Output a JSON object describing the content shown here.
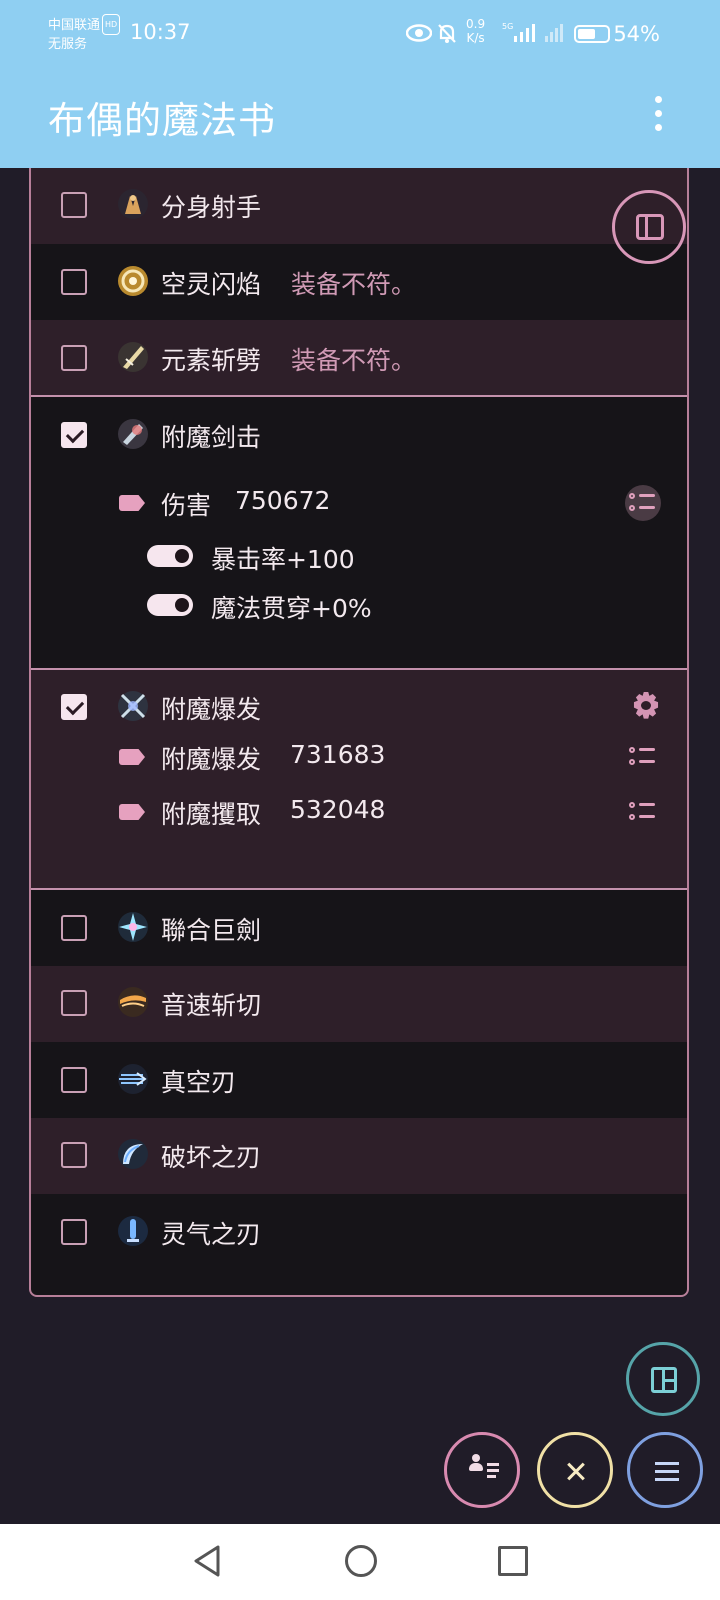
{
  "status_bar": {
    "carrier": "中国联通",
    "carrier_badge": "HD",
    "service": "无服务",
    "time": "10:37",
    "net_speed_value": "0.9",
    "net_speed_unit": "K/s",
    "signal_label": "5G",
    "battery": "54%"
  },
  "app_bar": {
    "title": "布偶的魔法书",
    "more_icon": "more-vert-icon"
  },
  "skills": [
    {
      "name": "分身射手",
      "checked": false,
      "note": ""
    },
    {
      "name": "空灵闪焰",
      "checked": false,
      "note": "装备不符。"
    },
    {
      "name": "元素斩劈",
      "checked": false,
      "note": "装备不符。"
    },
    {
      "name": "附魔剑击",
      "checked": true,
      "note": ""
    },
    {
      "name": "附魔爆发",
      "checked": true,
      "note": ""
    },
    {
      "name": "聯合巨劍",
      "checked": false,
      "note": ""
    },
    {
      "name": "音速斩切",
      "checked": false,
      "note": ""
    },
    {
      "name": "真空刃",
      "checked": false,
      "note": ""
    },
    {
      "name": "破坏之刃",
      "checked": false,
      "note": ""
    },
    {
      "name": "灵气之刃",
      "checked": false,
      "note": ""
    }
  ],
  "enchant_strike": {
    "damage_label": "伤害",
    "damage_value": "750672",
    "toggles": [
      {
        "label": "暴击率+100",
        "on": true
      },
      {
        "label": "魔法贯穿+0%",
        "on": true
      }
    ]
  },
  "enchant_burst": {
    "lines": [
      {
        "label": "附魔爆发",
        "value": "731683"
      },
      {
        "label": "附魔攫取",
        "value": "532048"
      }
    ]
  },
  "fabs": [
    "side-panel-icon",
    "layout-icon",
    "contact-list-icon",
    "close-icon",
    "menu-icon"
  ],
  "colors": {
    "app_bar": "#8fcff2",
    "background": "#201c28",
    "row_dark": "#161418",
    "row_tint": "#2e1f29",
    "accent_pink": "#d394b3",
    "warn_text": "#d09ab5"
  }
}
